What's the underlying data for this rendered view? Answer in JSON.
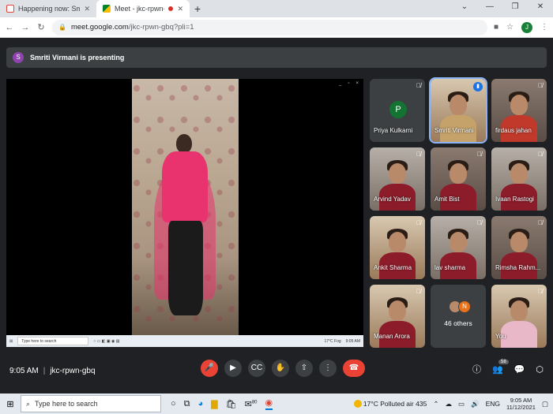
{
  "browser": {
    "tabs": [
      {
        "title": "Happening now: Smriti Virmani i",
        "favicon": "gmail-icon",
        "active": false
      },
      {
        "title": "Meet - jkc-rpwn-gbq",
        "favicon": "meet-icon",
        "active": true
      }
    ],
    "url_host": "meet.google.com",
    "url_path": "/jkc-rpwn-gbq?pli=1",
    "profile_initial": "J"
  },
  "presenting": {
    "avatar_initial": "S",
    "text": "Smriti Virmani is presenting"
  },
  "shared_screen": {
    "mini_search_placeholder": "Type here to search",
    "mini_weather": "17°C Fog",
    "mini_clock": "9:05 AM"
  },
  "participants": [
    {
      "name": "Priya Kulkarni",
      "type": "avatar",
      "initial": "P",
      "muted": true
    },
    {
      "name": "Smriti Virmani",
      "type": "camera",
      "muted": false,
      "speaking": true
    },
    {
      "name": "firdaus jahan",
      "type": "camera",
      "muted": true
    },
    {
      "name": "Arvind Yadav",
      "type": "camera",
      "muted": true
    },
    {
      "name": "Amit Bist",
      "type": "camera",
      "muted": true
    },
    {
      "name": "Ivaan Rastogi",
      "type": "camera",
      "muted": true
    },
    {
      "name": "Ankit Sharma",
      "type": "camera",
      "muted": true
    },
    {
      "name": "lav sharma",
      "type": "camera",
      "muted": true
    },
    {
      "name": "Rimsha Rahm...",
      "type": "camera",
      "muted": true
    },
    {
      "name": "Manan Arora",
      "type": "camera",
      "muted": true
    },
    {
      "name": "46 others",
      "type": "others",
      "initial": "N"
    },
    {
      "name": "You",
      "type": "camera",
      "muted": true
    }
  ],
  "meeting": {
    "time": "9:05 AM",
    "code": "jkc-rpwn-gbq",
    "people_count": "58"
  },
  "taskbar": {
    "search_placeholder": "Type here to search",
    "weather": "17°C  Polluted air 435",
    "language": "ENG",
    "time": "9:05 AM",
    "date": "11/12/2021",
    "edge_badge": "80"
  },
  "colors": {
    "background": "#202124",
    "tile": "#3c4043",
    "danger": "#ea4335",
    "accent": "#8ab4f8"
  }
}
